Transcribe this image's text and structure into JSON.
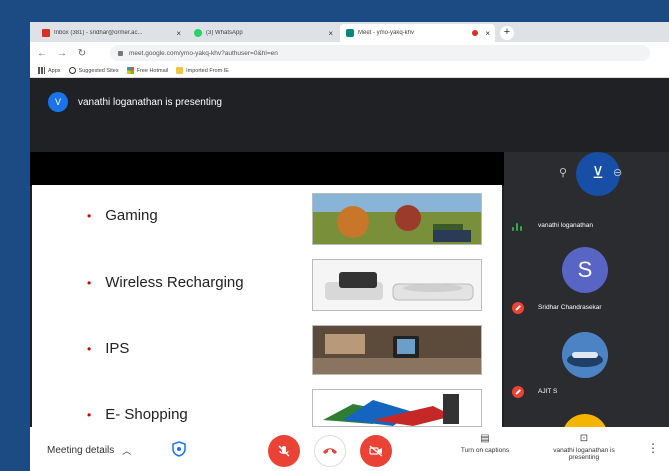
{
  "tabs": [
    {
      "label": "Inbox (381) - sridhar@ormer.ac...",
      "favicon_color": "#d93025",
      "active": false
    },
    {
      "label": "(3) WhatsApp",
      "favicon_color": "#25d366",
      "active": false
    },
    {
      "label": "Meet - ymo-yakq-khv",
      "favicon_color": "#00897b",
      "active": true
    }
  ],
  "toolbar": {
    "url": "meet.google.com/ymo-yakq-khv?authuser=0&hl=en"
  },
  "bookmarks": [
    "Apps",
    "Suggested Sites",
    "Free Hotmail",
    "Imported From IE"
  ],
  "presenter": {
    "initial": "V",
    "banner": "vanathi loganathan is presenting"
  },
  "slide": {
    "bullets": [
      "Gaming",
      "Wireless Recharging",
      "IPS",
      "E- Shopping"
    ]
  },
  "participants": [
    {
      "name": "vanathi loganathan",
      "state": "speaking"
    },
    {
      "name": "Sridhar Chandrasekar",
      "initial": "S",
      "state": "muted"
    },
    {
      "name": "AJIT S",
      "state": "muted"
    }
  ],
  "bottom": {
    "meeting_details": "Meeting details",
    "captions_label": "Turn on captions",
    "presenting_label": "vanathi loganathan is presenting"
  },
  "colors": {
    "accent": "#1a73e8",
    "danger": "#ea4335"
  }
}
